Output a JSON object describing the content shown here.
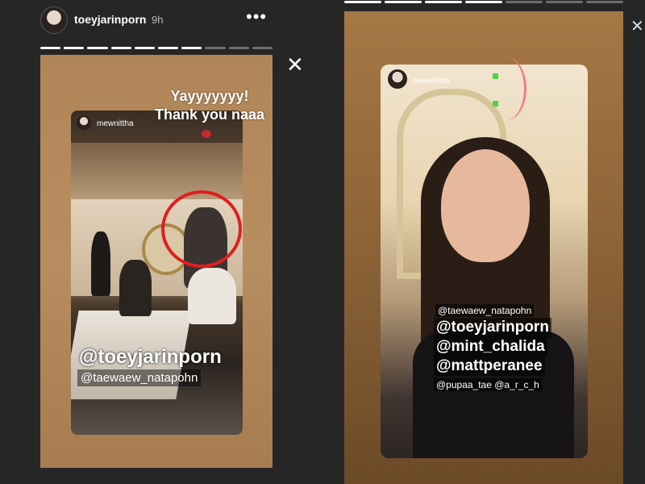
{
  "header": {
    "username": "toeyjarinporn",
    "time": "9h",
    "more": "•••",
    "close": "✕",
    "close_right": "✕"
  },
  "left_story": {
    "overlay_text_line1": "Yayyyyyyy!",
    "overlay_text_line2": "Thank you naaa",
    "inner_username": "mewnittha",
    "mention_primary": "@toeyjarinporn",
    "mention_secondary": "@taewaew_natapohn",
    "highlight_color": "#e01e1e"
  },
  "right_story": {
    "inner_username": "mewnittha",
    "mentions": {
      "taewaew": "@taewaew_natapohn",
      "toey": "@toeyjarinporn",
      "mint": "@mint_chalida",
      "matt": "@mattperanee",
      "bottom": "@pupaa_tae @a_r_c_h"
    },
    "indicator_color": "#4cd34c"
  },
  "icons": [
    "avatar",
    "more-options-icon",
    "close-icon",
    "lips-sticker-icon"
  ]
}
